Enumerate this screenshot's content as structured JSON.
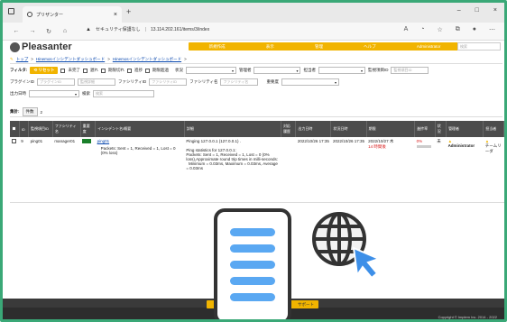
{
  "browser": {
    "tab_title": "プリザンター",
    "address_warning": "セキュリティ保護なし",
    "address_url": "13.114.202.161/items/3/index"
  },
  "app": {
    "logo": "Pleasanter",
    "menu": [
      "新規作成",
      "表示",
      "管理",
      "ヘルプ",
      "Administrator"
    ],
    "search_placeholder": "検索"
  },
  "breadcrumb": [
    "トップ",
    "Hinemosインシデントダッシュボード",
    "Hinemosインシデントダッシュボード"
  ],
  "filter": {
    "label": "フィルタ:",
    "reset": "リセット",
    "checks": [
      "未完了",
      "遅れ",
      "期限切れ",
      "進捗",
      "期限超過"
    ],
    "status_label": "状況",
    "manager_label": "管理者",
    "owner_label": "担当者",
    "monitor_id_label": "監視項目ID",
    "monitor_id_placeholder": "監視項目ID",
    "plugin_id_label": "プラグインID",
    "plugin_id_placeholder": "プラグインID",
    "monitor_detail_placeholder": "監視詳細",
    "facility_id_label": "ファシリティID",
    "facility_id_placeholder": "ファシリティID",
    "facility_name_label": "ファシリティ名",
    "facility_name_placeholder": "ファシリティ名",
    "severity_label": "重要度",
    "output_date_label": "出力日時",
    "search_label": "検索",
    "search_placeholder": "検索"
  },
  "total": {
    "label": "集計:",
    "button": "件数",
    "count": "2"
  },
  "table": {
    "headers": [
      "ID",
      "監視項目ID",
      "ファシリティ名",
      "重要度",
      "インシデント名/概要",
      "詳細",
      "対応履歴",
      "出力日時",
      "状況日時",
      "期限",
      "進捗率",
      "状況",
      "管理者",
      "担当者"
    ],
    "row": {
      "id": "9",
      "monitor_id": "ping01",
      "facility": "manager01",
      "title": "ping01",
      "summary": "Packets: Sent = 1, Received = 1, Lost = 0 (0% loss)",
      "detail": "Pinging 127.0.0.1 (127.0.0.1) .\n\nPing statistics for 127.0.0.1:\nPackets: Sent = 1, Received = 1, Lost = 0 (0% loss),Approximate round trip times in milli-seconds:\n  Minimum = 0.03ms, Maximum = 0.03ms, Average = 0.03ms",
      "output_date": "2022/10/26 17:35",
      "status_date": "2022/10/26 17:35",
      "deadline": "2022/10/27 木",
      "deadline_note": "14 時間後",
      "progress": "0%",
      "progress_value": 0,
      "status": "未",
      "manager": "Administrator",
      "owner": "チームリーダ"
    }
  },
  "footer": {
    "support": "サポート",
    "copyright": "Copyright © Implem Inc. 2014 - 2022"
  },
  "colors": {
    "accent": "#f1b400",
    "header_dark": "#4c4c4c",
    "frame": "#3aa877",
    "doc_lines": "#5aa8f2",
    "cursor": "#3d8fe8"
  }
}
